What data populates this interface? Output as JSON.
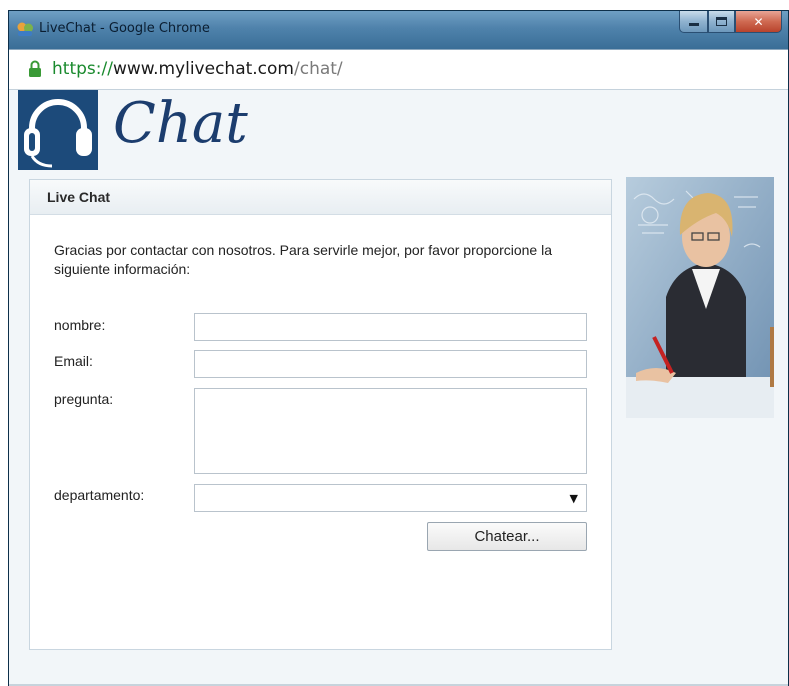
{
  "window": {
    "title": "LiveChat - Google Chrome",
    "url_scheme": "https://",
    "url_host": "www.mylivechat.com",
    "url_path": "/chat/"
  },
  "header": {
    "logo_text": "Chat"
  },
  "panel": {
    "title": "Live Chat",
    "intro": "Gracias por contactar con nosotros. Para servirle mejor, por favor proporcione la siguiente información:"
  },
  "form": {
    "name_label": "nombre:",
    "name_value": "",
    "email_label": "Email:",
    "email_value": "",
    "question_label": "pregunta:",
    "question_value": "",
    "department_label": "departamento:",
    "department_selected": "",
    "submit_label": "Chatear..."
  },
  "icons": {
    "title": "livechat-app-icon",
    "lock": "lock-icon",
    "logo": "headset-icon",
    "select": "chevron-down-icon"
  },
  "colors": {
    "frame": "#1e5a86",
    "url_secure": "#1a8a2e",
    "logo_bg": "#1c4a7a",
    "logo_text": "#1c3d6e"
  }
}
